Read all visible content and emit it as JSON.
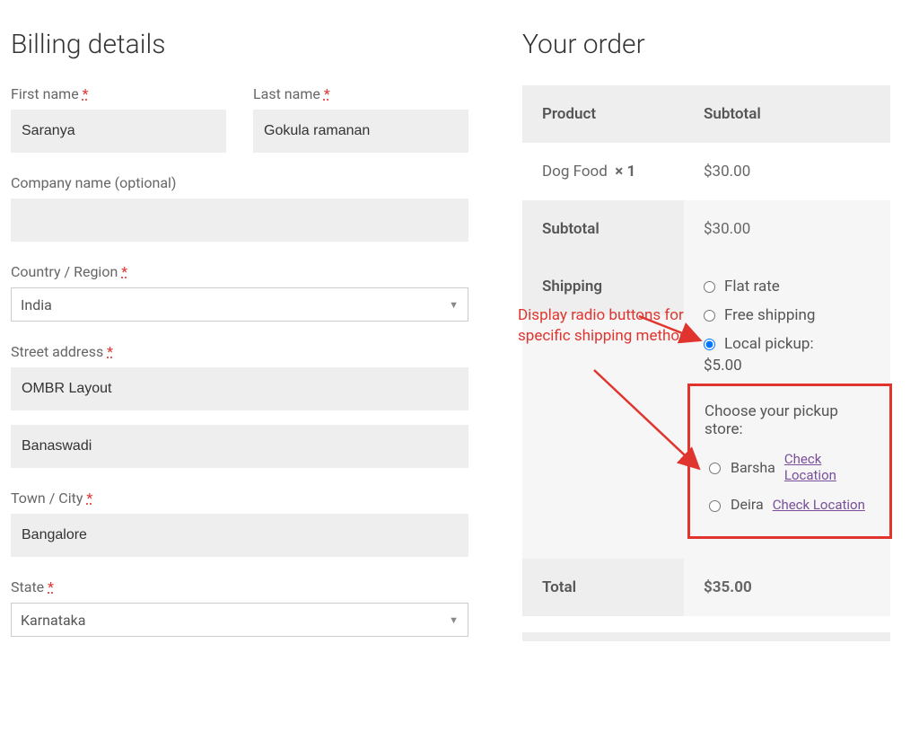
{
  "billing": {
    "heading": "Billing details",
    "first_name_label": "First name",
    "first_name_value": "Saranya",
    "last_name_label": "Last name",
    "last_name_value": "Gokula ramanan",
    "company_label": "Company name (optional)",
    "company_value": "",
    "country_label": "Country / Region",
    "country_value": "India",
    "street_label": "Street address",
    "street1_value": "OMBR Layout",
    "street2_value": "Banaswadi",
    "city_label": "Town / City",
    "city_value": "Bangalore",
    "state_label": "State",
    "state_value": "Karnataka",
    "required_marker": "*"
  },
  "order": {
    "heading": "Your order",
    "col_product": "Product",
    "col_subtotal": "Subtotal",
    "item_name": "Dog Food",
    "item_qty": "× 1",
    "item_price": "$30.00",
    "subtotal_label": "Subtotal",
    "subtotal_value": "$30.00",
    "shipping_label": "Shipping",
    "ship_flat": "Flat rate",
    "ship_free": "Free shipping",
    "ship_local": "Local pickup:",
    "ship_local_price": "$5.00",
    "pickup_title": "Choose your pickup store:",
    "store1": "Barsha",
    "store1_link": " Check Location",
    "store2": "Deira",
    "store2_link": " Check Location",
    "total_label": "Total",
    "total_value": "$35.00"
  },
  "annotation": {
    "text": "Display radio buttons for specific shipping method"
  }
}
